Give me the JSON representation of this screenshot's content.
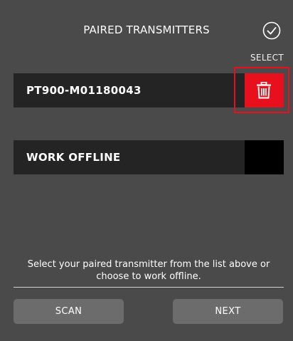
{
  "header": {
    "title": "PAIRED TRANSMITTERS",
    "confirm_icon": "check-circle-icon"
  },
  "list": {
    "column_label": "SELECT",
    "items": [
      {
        "label": "PT900-M01180043",
        "action_icon": "trash-icon",
        "action_color": "#e8101c"
      },
      {
        "label": "WORK OFFLINE"
      }
    ]
  },
  "footer": {
    "hint": "Select your paired transmitter from the list above or choose to work offline.",
    "scan_label": "SCAN",
    "next_label": "NEXT"
  },
  "colors": {
    "background": "#4a4a4a",
    "row": "#242424",
    "accent": "#e8101c",
    "button": "#6c6c6c"
  }
}
